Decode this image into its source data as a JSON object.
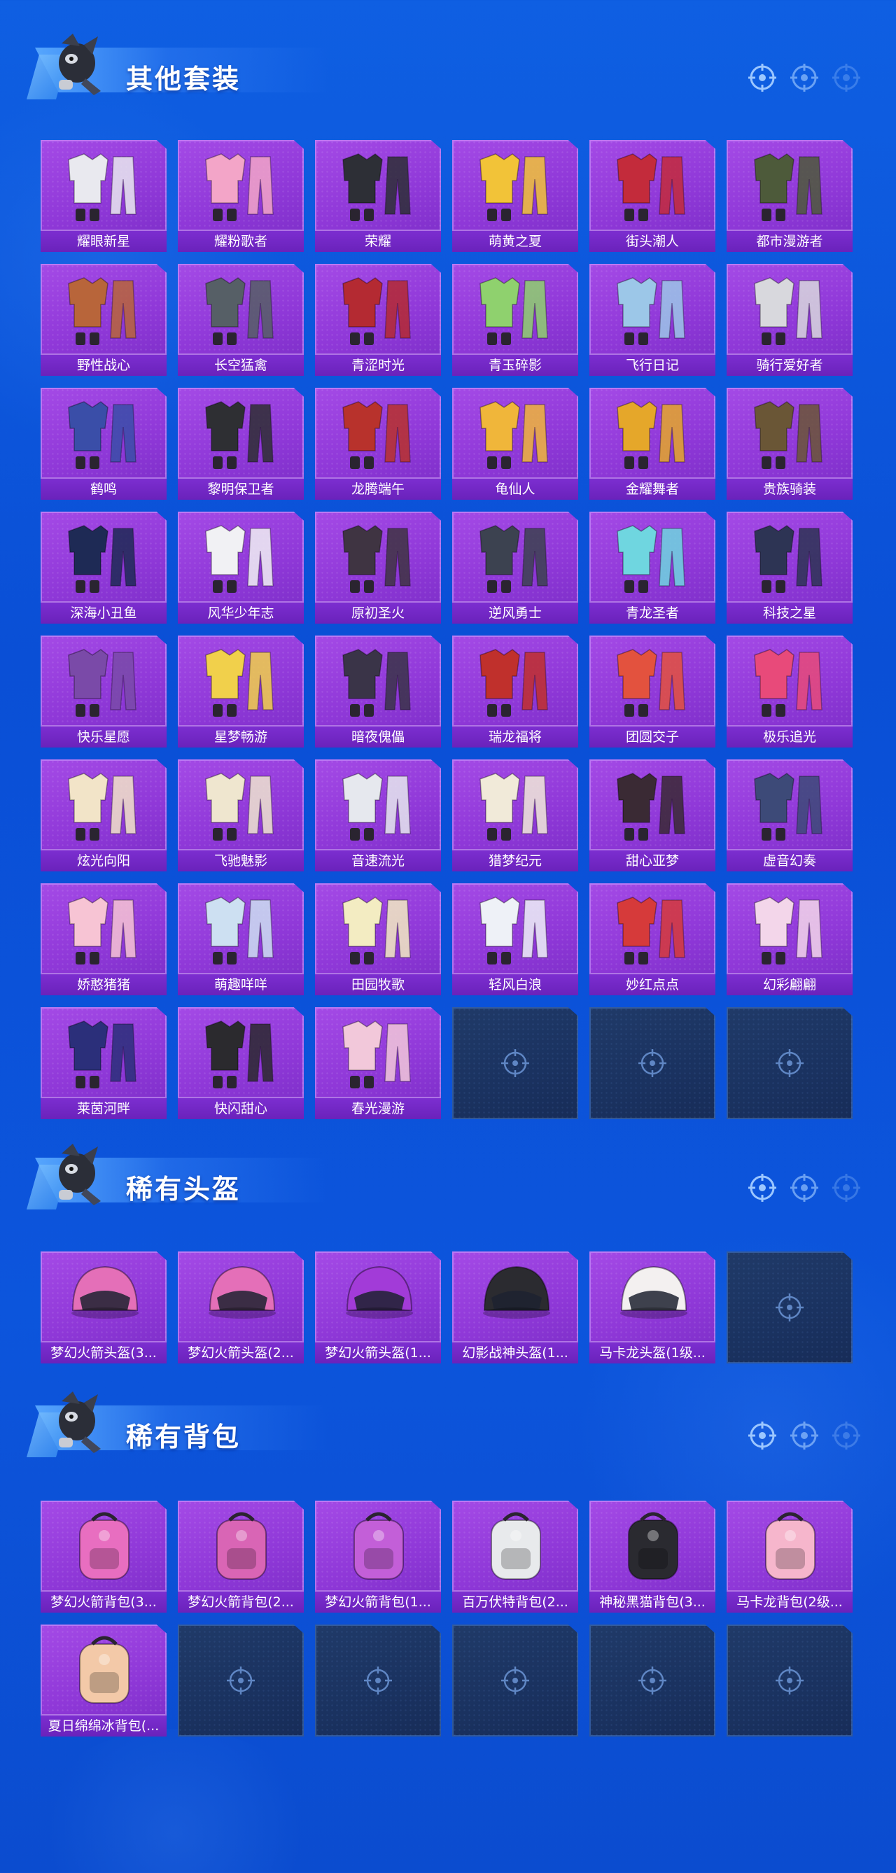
{
  "colors": {
    "background": "#0b55dc",
    "card_purple": "#9a40e0",
    "card_label": "#6e25be",
    "card_empty": "#1c3462",
    "title_text": "#ffffff"
  },
  "sections": [
    {
      "title": "其他套装",
      "items": [
        {
          "name": "耀眼新星",
          "icon": "outfit-icon",
          "tint": "#e9e9ef"
        },
        {
          "name": "耀粉歌者",
          "icon": "outfit-icon",
          "tint": "#f3a5c8"
        },
        {
          "name": "荣耀",
          "icon": "outfit-icon",
          "tint": "#2d2f36"
        },
        {
          "name": "萌黄之夏",
          "icon": "outfit-icon",
          "tint": "#f2c338"
        },
        {
          "name": "街头潮人",
          "icon": "outfit-icon",
          "tint": "#c32b3b"
        },
        {
          "name": "都市漫游者",
          "icon": "outfit-icon",
          "tint": "#4d5a3a"
        },
        {
          "name": "野性战心",
          "icon": "outfit-icon",
          "tint": "#b8653a"
        },
        {
          "name": "长空猛禽",
          "icon": "outfit-icon",
          "tint": "#565f66"
        },
        {
          "name": "青涩时光",
          "icon": "outfit-icon",
          "tint": "#b42a32"
        },
        {
          "name": "青玉碎影",
          "icon": "outfit-icon",
          "tint": "#8fd16e"
        },
        {
          "name": "飞行日记",
          "icon": "outfit-icon",
          "tint": "#9cc7e8"
        },
        {
          "name": "骑行爱好者",
          "icon": "outfit-icon",
          "tint": "#d8d8dd"
        },
        {
          "name": "鹤鸣",
          "icon": "outfit-icon",
          "tint": "#3a4ea8"
        },
        {
          "name": "黎明保卫者",
          "icon": "outfit-icon",
          "tint": "#2e2f33"
        },
        {
          "name": "龙腾端午",
          "icon": "outfit-icon",
          "tint": "#b8322c"
        },
        {
          "name": "龟仙人",
          "icon": "outfit-icon",
          "tint": "#f0b63a"
        },
        {
          "name": "金耀舞者",
          "icon": "outfit-icon",
          "tint": "#e5a72a"
        },
        {
          "name": "贵族骑装",
          "icon": "outfit-icon",
          "tint": "#6a5636"
        },
        {
          "name": "深海小丑鱼",
          "icon": "outfit-icon",
          "tint": "#1e2a55"
        },
        {
          "name": "风华少年志",
          "icon": "outfit-icon",
          "tint": "#f1f1f4"
        },
        {
          "name": "原初圣火",
          "icon": "outfit-icon",
          "tint": "#3f3442"
        },
        {
          "name": "逆风勇士",
          "icon": "outfit-icon",
          "tint": "#3c4250"
        },
        {
          "name": "青龙圣者",
          "icon": "outfit-icon",
          "tint": "#6fd6e0"
        },
        {
          "name": "科技之星",
          "icon": "outfit-icon",
          "tint": "#2d3454"
        },
        {
          "name": "快乐星愿",
          "icon": "outfit-icon",
          "tint": "#7a4aa8"
        },
        {
          "name": "星梦畅游",
          "icon": "outfit-icon",
          "tint": "#f1d04b"
        },
        {
          "name": "暗夜傀儡",
          "icon": "outfit-icon",
          "tint": "#3a3448"
        },
        {
          "name": "瑞龙福将",
          "icon": "outfit-icon",
          "tint": "#c0302c"
        },
        {
          "name": "团圆交子",
          "icon": "outfit-icon",
          "tint": "#e3523e"
        },
        {
          "name": "极乐追光",
          "icon": "outfit-icon",
          "tint": "#e84a7a"
        },
        {
          "name": "炫光向阳",
          "icon": "outfit-icon",
          "tint": "#f2e4c8"
        },
        {
          "name": "飞驰魅影",
          "icon": "outfit-icon",
          "tint": "#efe6cf"
        },
        {
          "name": "音速流光",
          "icon": "outfit-icon",
          "tint": "#e6e8ee"
        },
        {
          "name": "猎梦纪元",
          "icon": "outfit-icon",
          "tint": "#f1ead9"
        },
        {
          "name": "甜心亚梦",
          "icon": "outfit-icon",
          "tint": "#3a2a34"
        },
        {
          "name": "虚音幻奏",
          "icon": "outfit-icon",
          "tint": "#3d4a78"
        },
        {
          "name": "娇憨猪猪",
          "icon": "outfit-icon",
          "tint": "#f7c4d4"
        },
        {
          "name": "萌趣咩咩",
          "icon": "outfit-icon",
          "tint": "#cde0f2"
        },
        {
          "name": "田园牧歌",
          "icon": "outfit-icon",
          "tint": "#f3ecc2"
        },
        {
          "name": "轻风白浪",
          "icon": "outfit-icon",
          "tint": "#eef1f7"
        },
        {
          "name": "妙红点点",
          "icon": "outfit-icon",
          "tint": "#d63a3a"
        },
        {
          "name": "幻彩翩翩",
          "icon": "outfit-icon",
          "tint": "#f3d6ea"
        },
        {
          "name": "莱茵河畔",
          "icon": "outfit-icon",
          "tint": "#2b2f7a"
        },
        {
          "name": "快闪甜心",
          "icon": "outfit-icon",
          "tint": "#2b2a2e"
        },
        {
          "name": "春光漫游",
          "icon": "outfit-icon",
          "tint": "#f2c8da"
        },
        {
          "name": "",
          "icon": "crosshair-icon",
          "empty": true
        },
        {
          "name": "",
          "icon": "crosshair-icon",
          "empty": true
        },
        {
          "name": "",
          "icon": "crosshair-icon",
          "empty": true
        }
      ]
    },
    {
      "title": "稀有头盔",
      "items": [
        {
          "name": "梦幻火箭头盔(3...",
          "icon": "helmet-icon",
          "tint": "#e46fb8"
        },
        {
          "name": "梦幻火箭头盔(2...",
          "icon": "helmet-icon",
          "tint": "#e46fb8"
        },
        {
          "name": "梦幻火箭头盔(1...",
          "icon": "helmet-icon",
          "tint": "#a23bd8"
        },
        {
          "name": "幻影战神头盔(1...",
          "icon": "helmet-icon",
          "tint": "#2b2b30"
        },
        {
          "name": "马卡龙头盔(1级...",
          "icon": "helmet-icon",
          "tint": "#f3f0f0"
        },
        {
          "name": "",
          "icon": "crosshair-icon",
          "empty": true
        }
      ]
    },
    {
      "title": "稀有背包",
      "items": [
        {
          "name": "梦幻火箭背包(3...",
          "icon": "backpack-icon",
          "tint": "#e86ec0"
        },
        {
          "name": "梦幻火箭背包(2...",
          "icon": "backpack-icon",
          "tint": "#d965b5"
        },
        {
          "name": "梦幻火箭背包(1...",
          "icon": "backpack-icon",
          "tint": "#c35fd8"
        },
        {
          "name": "百万伏特背包(2...",
          "icon": "backpack-icon",
          "tint": "#e8eaec"
        },
        {
          "name": "神秘黑猫背包(3...",
          "icon": "backpack-icon",
          "tint": "#2a2a30"
        },
        {
          "name": "马卡龙背包(2级...",
          "icon": "backpack-icon",
          "tint": "#f6b6cc"
        },
        {
          "name": "夏日绵绵冰背包(...",
          "icon": "backpack-icon",
          "tint": "#f3c9a8"
        },
        {
          "name": "",
          "icon": "crosshair-icon",
          "empty": true
        },
        {
          "name": "",
          "icon": "crosshair-icon",
          "empty": true
        },
        {
          "name": "",
          "icon": "crosshair-icon",
          "empty": true
        },
        {
          "name": "",
          "icon": "crosshair-icon",
          "empty": true
        },
        {
          "name": "",
          "icon": "crosshair-icon",
          "empty": true
        }
      ]
    }
  ]
}
